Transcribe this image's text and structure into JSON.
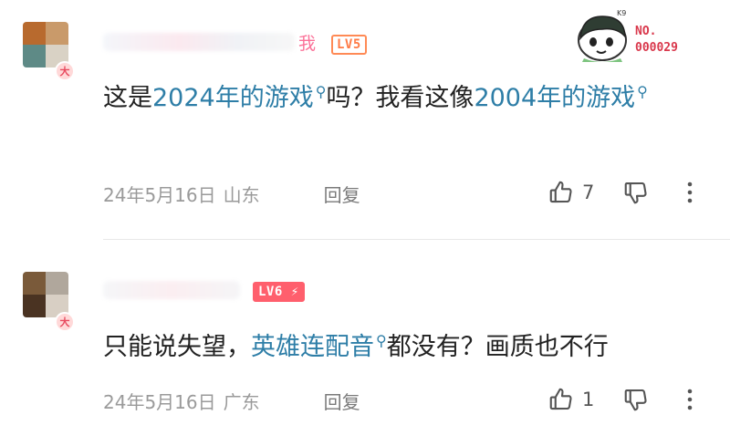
{
  "watermark": {
    "label": "NO.",
    "number": "000029",
    "mark": "K9"
  },
  "comments": [
    {
      "avatar_colors": [
        "#b86a2e",
        "#c99a6a",
        "#5e8a86",
        "#d9d2c5"
      ],
      "vip_badge": "大",
      "username_tail": "我",
      "level": "LV5",
      "content": {
        "part1": "这是",
        "link1": "2024年的游戏",
        "part2": "吗？我看这像",
        "link2": "2004年的游戏"
      },
      "date": "24年5月16日",
      "location": "山东",
      "reply_label": "回复",
      "like_count": "7"
    },
    {
      "avatar_colors": [
        "#7a5a3a",
        "#b0a79c",
        "#4a3322",
        "#d8cfc4"
      ],
      "vip_badge": "大",
      "level": "LV6 ⚡",
      "content": {
        "part1": "只能说失望，",
        "link1": "英雄连配音",
        "part2": "都没有？画质也不行"
      },
      "date": "24年5月16日",
      "location": "广东",
      "reply_label": "回复",
      "like_count": "1"
    }
  ],
  "colors": {
    "link": "#2e7ea7",
    "meta": "#9a9a9a",
    "level5": "#ff7a45",
    "level6": "#ff5f6d",
    "username_pink": "#fb7299"
  },
  "icons": {
    "link_icon": "search-icon",
    "like": "thumbs-up-icon",
    "dislike": "thumbs-down-icon",
    "more": "more-vertical-icon"
  }
}
